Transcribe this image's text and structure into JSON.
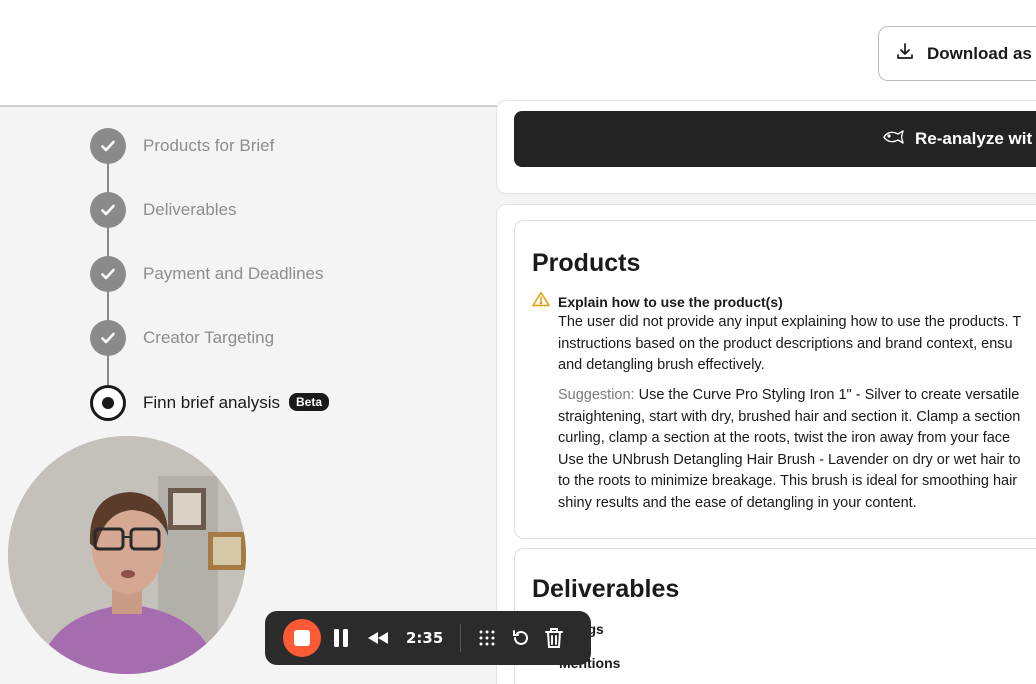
{
  "header": {
    "download_label": "Download as",
    "download_icon": "download-icon"
  },
  "steps": [
    {
      "label": "Products for Brief",
      "status": "complete"
    },
    {
      "label": "Deliverables",
      "status": "complete"
    },
    {
      "label": "Payment and Deadlines",
      "status": "complete"
    },
    {
      "label": "Creator Targeting",
      "status": "complete"
    },
    {
      "label": "Finn brief analysis",
      "status": "current",
      "badge": "Beta"
    }
  ],
  "reanalyze": {
    "label": "Re-analyze wit",
    "icon": "fish-icon"
  },
  "products": {
    "title": "Products",
    "warning_title": "Explain how to use the product(s)",
    "warning_lines": [
      "The user did not provide any input explaining how to use the products. T",
      "instructions based on the product descriptions and brand context, ensu",
      "and detangling brush effectively."
    ],
    "suggestion_label": "Suggestion:",
    "suggestion_first": " Use the Curve Pro Styling Iron 1\" - Silver to create versatile",
    "suggestion_lines": [
      "straightening, start with dry, brushed hair and section it. Clamp a section",
      "curling, clamp a section at the roots, twist the iron away from your face",
      "Use the UNbrush Detangling Hair Brush - Lavender on dry or wet hair to",
      "to the roots to minimize breakage. This brush is ideal for smoothing hair",
      "shiny results and the ease of detangling in your content."
    ]
  },
  "deliverables": {
    "title": "Deliverables",
    "items": [
      "tags",
      "Mentions"
    ]
  },
  "recorder": {
    "time": "2:35",
    "stop_color": "#ff5a36"
  },
  "colors": {
    "accent_dark": "#232323",
    "step_complete": "#8a8a8a",
    "warning": "#e0a100"
  }
}
